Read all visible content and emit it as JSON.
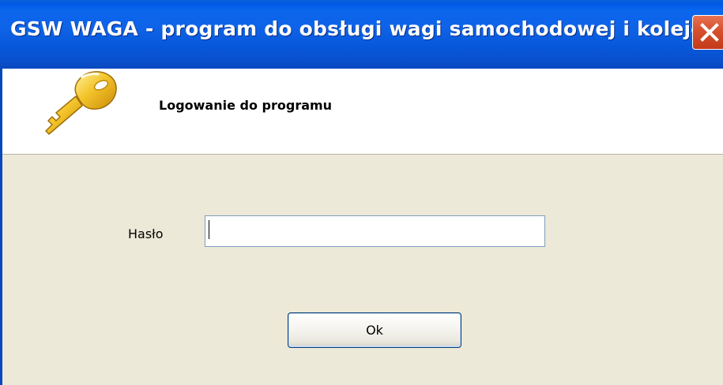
{
  "window": {
    "title": "GSW WAGA - program do obsługi wagi samochodowej i kolejowej"
  },
  "header": {
    "title": "Logowanie do programu",
    "icon": "key-icon"
  },
  "form": {
    "password_label": "Hasło",
    "password_value": "",
    "ok_label": "Ok"
  },
  "colors": {
    "titlebar": "#0a5fd8",
    "close_button": "#d5502d",
    "panel_background": "#ece9d8",
    "header_background": "#ffffff"
  }
}
